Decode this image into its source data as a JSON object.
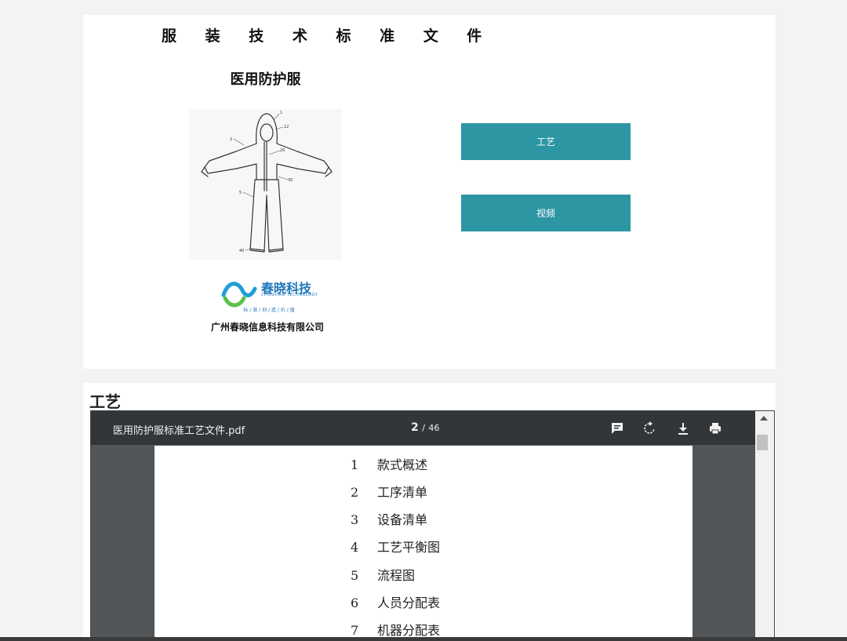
{
  "doc_title": "服 装 技 术 标 准 文 件",
  "product_title": "医用防护服",
  "logo": {
    "brand_cn": "春晓科技",
    "brand_en": "CHUNXIAO TECHNOLOGY",
    "slogan": "标 / 准 / 创 / 造 / 价 / 值"
  },
  "company": "广州春晓信息科技有限公司",
  "buttons": {
    "craft": "工艺",
    "video": "视频"
  },
  "section_title": "工艺",
  "pdf_viewer": {
    "filename": "医用防护服标准工艺文件.pdf",
    "current_page": "2",
    "separator": "/",
    "total_pages": "46",
    "icons": [
      "comment-icon",
      "rotate-icon",
      "download-icon",
      "print-icon"
    ]
  },
  "toc": [
    {
      "num": "1",
      "label": "款式概述"
    },
    {
      "num": "2",
      "label": "工序清单"
    },
    {
      "num": "3",
      "label": "设备清单"
    },
    {
      "num": "4",
      "label": "工艺平衡图"
    },
    {
      "num": "5",
      "label": "流程图"
    },
    {
      "num": "6",
      "label": "人员分配表"
    },
    {
      "num": "7",
      "label": "机器分配表"
    }
  ],
  "colors": {
    "accent": "#2c96a3",
    "toolbar": "#323639",
    "viewer_bg": "#525659",
    "page_bg": "#f3f3f3"
  }
}
